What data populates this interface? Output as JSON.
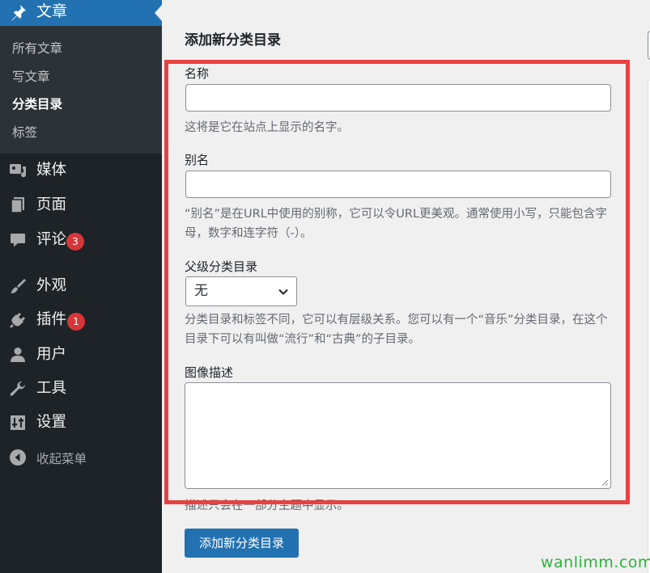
{
  "sidebar": {
    "current": {
      "label": "文章",
      "icon": "pin-icon"
    },
    "submenu": [
      {
        "label": "所有文章",
        "active": false
      },
      {
        "label": "写文章",
        "active": false
      },
      {
        "label": "分类目录",
        "active": true
      },
      {
        "label": "标签",
        "active": false
      }
    ],
    "items": [
      {
        "label": "媒体",
        "icon": "media-icon"
      },
      {
        "label": "页面",
        "icon": "page-icon"
      },
      {
        "label": "评论",
        "icon": "comment-icon",
        "badge": "3"
      },
      {
        "label": "外观",
        "icon": "brush-icon"
      },
      {
        "label": "插件",
        "icon": "plugin-icon",
        "badge": "1"
      },
      {
        "label": "用户",
        "icon": "user-icon"
      },
      {
        "label": "工具",
        "icon": "wrench-icon"
      },
      {
        "label": "设置",
        "icon": "settings-icon"
      },
      {
        "label": "收起菜单",
        "icon": "collapse-icon"
      }
    ]
  },
  "form": {
    "heading": "添加新分类目录",
    "name": {
      "label": "名称",
      "value": "",
      "help": "这将是它在站点上显示的名字。"
    },
    "slug": {
      "label": "别名",
      "value": "",
      "help": "“别名”是在URL中使用的别称，它可以令URL更美观。通常使用小写，只能包含字母，数字和连字符（-）。"
    },
    "parent": {
      "label": "父级分类目录",
      "selected": "无",
      "help": "分类目录和标签不同，它可以有层级关系。您可以有一个“音乐”分类目录，在这个目录下可以有叫做“流行”和“古典”的子目录。"
    },
    "description": {
      "label": "图像描述",
      "value": "",
      "help": "描述只会在一部分主题中显示。"
    },
    "submit_label": "添加新分类目录"
  },
  "watermark": "wanlimm.com",
  "colors": {
    "sidebar_bg": "#1d2327",
    "submenu_bg": "#2c3338",
    "accent": "#2271b1",
    "badge": "#d63638",
    "highlight": "#e94040",
    "watermark": "#2fb23c"
  }
}
